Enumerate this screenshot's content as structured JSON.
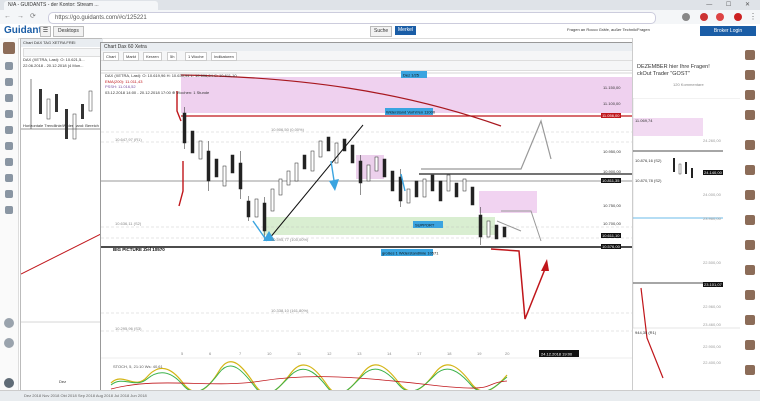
{
  "browser": {
    "tab_title": "N/A - GUIDANTS - der Kontor: Stream ...",
    "url": "https://go.guidants.com/#c/125221",
    "window_controls": "— ☐ ✕"
  },
  "app": {
    "logo": "Guidants",
    "header_buttons": [
      "Chart",
      "Desktops"
    ],
    "trade_button": "Broker Login",
    "panel_tabs": [
      "Suche",
      "Merkel"
    ],
    "panel_tab_right": "Fragen an Rocco Gräfe, außer Technik/Fragen"
  },
  "bg_window": {
    "title": "Chart DAX TAG XETRA FREI",
    "subtitle": "DAX (XETRA, Last): O: 10.621,5...",
    "legend_line": "22.06.2018 - 20.12.2018 (4 Mon...",
    "annotation": "Horizontale Trendlinie/Widerstand: Bereich...",
    "bottom_label": "Dez"
  },
  "main_window": {
    "title": "Chart Dax 60 Xetra",
    "toolbar": [
      "Chart",
      "Markt",
      "Kerzen",
      "5h",
      "1 Woche",
      "Indikatoren"
    ],
    "legend": [
      "DAX (XETRA, Last): O: 10.619,96 H: 10.630,94 L: 10.606,24 C: 10.611,10",
      "EMA(200): 11.011,43",
      "PSSH: 11.016,52",
      "03.12.2018 14:00 - 20.12.2018 17:00 ⊕ Wochen: 1 Stunde"
    ],
    "labels": {
      "dez_box": "Dez 1/25",
      "widerstand": "Widerstand Vorhl?en 11000",
      "support": "SUPPORT",
      "bigpicture": "BIG PICTURE Ziel 10570",
      "unterstuetzung": "großes 1 Widerstandlinie 10571",
      "fib1": "10.906,50 (0,00%)",
      "fib2": "10.647,97 (R1)",
      "fib3": "10.636,11 (S2)",
      "fib4": "10.595,77 (100,00%)",
      "fib5": "10.338,10 (161,80%)",
      "fib6": "10.295,96 (S3)",
      "fib7": "10.275,90 (S3)",
      "stoch": "STOCH, 5, 21:10 Ws: 40,61",
      "date_box": "24.12.2018 19:00"
    },
    "x_ticks": [
      "5",
      "6",
      "7",
      "10",
      "11",
      "12",
      "13",
      "14",
      "17",
      "18",
      "19",
      "20"
    ],
    "price_boxes": [
      {
        "text": "11.150,00",
        "color": "#999"
      },
      {
        "text": "11.100,00",
        "color": "#999"
      },
      {
        "text": "11.056,00",
        "color": "#999"
      },
      {
        "text": "10.950,00",
        "color": "#999"
      },
      {
        "text": "10.900,00",
        "color": "#999"
      },
      {
        "text": "10.811,35",
        "color": "#000"
      },
      {
        "text": "10.750,00",
        "color": "#999"
      },
      {
        "text": "10.700,00",
        "color": "#999"
      },
      {
        "text": "10.611,10",
        "color": "#000"
      },
      {
        "text": "10.576,00",
        "color": "#000"
      }
    ]
  },
  "right_panel": {
    "title_line1": "DEZEMBER hier Ihre Fragen!",
    "title_line2": "ckOut Trader \"GOST\"",
    "count_label": "120 Kommentare",
    "prices": [
      "11.069,74",
      "24.260,00",
      "10.876,16 (S2)",
      "24.140,00",
      "10.870,78 (S2)",
      "24.000,00",
      "23.960,00",
      "22.500,00",
      "23.101,07",
      "22.960,00",
      "23.460,00",
      "944,35 (R1)",
      "22.900,00",
      "22.400,00"
    ]
  },
  "bottom_bar": "Dez 2018   Nov 2018   Okt 2018   Sep 2018   Aug 2018   Jul 2018   Jun 2018",
  "colors": {
    "accent": "#1a5da6",
    "red_line": "#c0161b",
    "magenta_zone": "#e9b7e8",
    "green_zone": "#cfeac5",
    "blue_box": "#3aa4e0"
  }
}
